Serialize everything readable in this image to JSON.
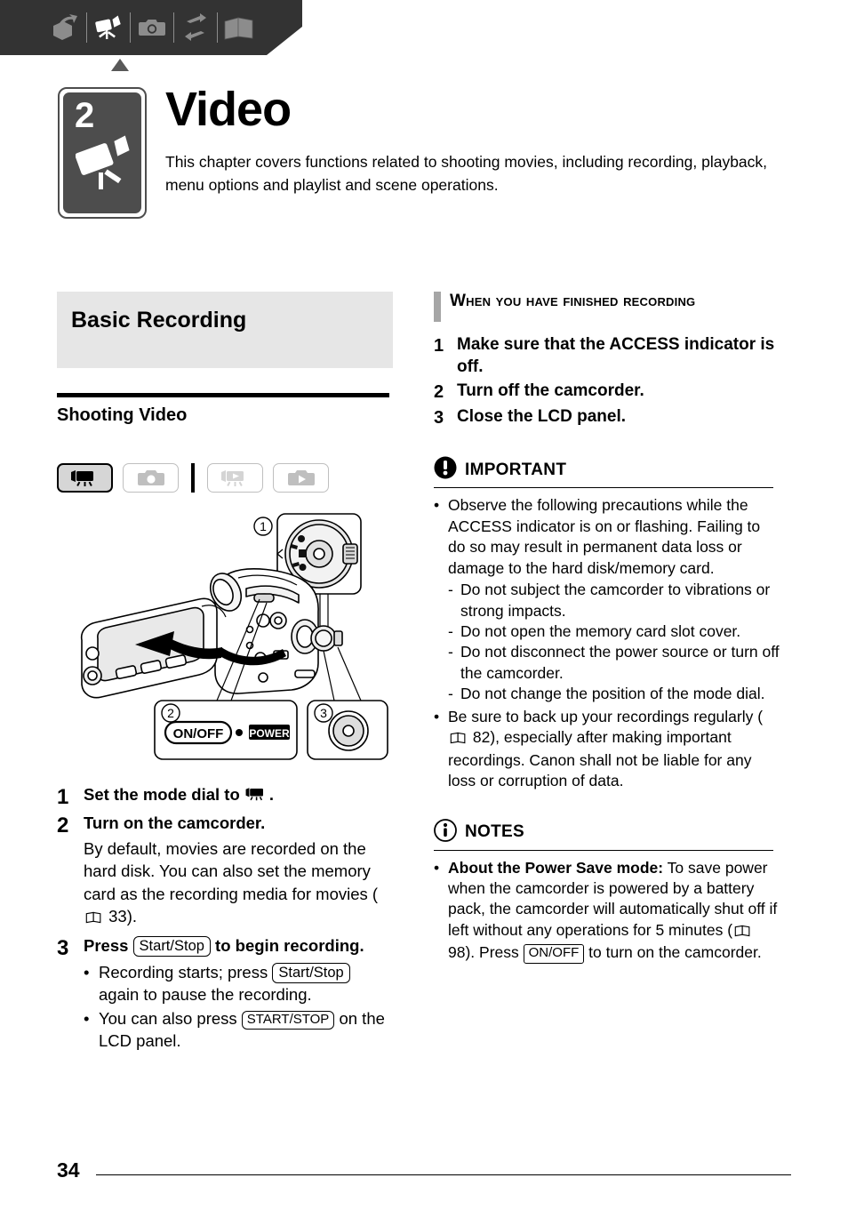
{
  "header": {
    "tabs": [
      {
        "name": "introduction-icon",
        "label": "Introduction",
        "active": false
      },
      {
        "name": "video-icon",
        "label": "Video",
        "active": true
      },
      {
        "name": "photos-icon",
        "label": "Photos",
        "active": false
      },
      {
        "name": "external-connections-icon",
        "label": "External Connections",
        "active": false
      },
      {
        "name": "additional-information-icon",
        "label": "Additional Information",
        "active": false
      }
    ]
  },
  "chapter": {
    "number": "2",
    "title": "Video",
    "description": "This chapter covers functions related to shooting movies, including recording, playback, menu options and playlist and scene operations."
  },
  "left": {
    "section_title": "Basic Recording",
    "subhead": "Shooting Video",
    "modes": [
      {
        "name": "mode-video-record",
        "label": "Video recording",
        "state": "active"
      },
      {
        "name": "mode-photo-record",
        "label": "Photo recording",
        "state": "inactive"
      },
      {
        "name": "mode-video-play",
        "label": "Video playback",
        "state": "inactive"
      },
      {
        "name": "mode-photo-play",
        "label": "Photo playback",
        "state": "inactive"
      }
    ],
    "figure": {
      "callout1": "1",
      "callout2": "2",
      "callout3": "3",
      "onoff_label": "ON/OFF",
      "power_label": "POWER"
    },
    "steps": [
      {
        "num": "1",
        "head_pre": "Set the mode dial to ",
        "head_icon": "camcorder-mode-icon",
        "head_post": ".",
        "body": "",
        "bullets": []
      },
      {
        "num": "2",
        "head_pre": "Turn on the camcorder.",
        "head_icon": "",
        "head_post": "",
        "body_pre": "By default, movies are recorded on the hard disk. You can also set the memory card as the recording media for movies (",
        "body_ref": "33",
        "body_post": ").",
        "bullets": []
      },
      {
        "num": "3",
        "head_pre": "Press ",
        "head_key": "Start/Stop",
        "head_post": " to begin recording.",
        "bullets": [
          {
            "pre": "Recording starts; press ",
            "key": "Start/Stop",
            "post": " again to pause the recording."
          },
          {
            "pre": "You can also press ",
            "key": "START/STOP",
            "post": " on the LCD panel."
          }
        ]
      }
    ]
  },
  "right": {
    "subsection_title": "When you have finished recording",
    "steps": [
      {
        "num": "1",
        "text": "Make sure that the ACCESS indicator is off."
      },
      {
        "num": "2",
        "text": "Turn off the camcorder."
      },
      {
        "num": "3",
        "text": "Close the LCD panel."
      }
    ],
    "important": {
      "label": "IMPORTANT",
      "bullets": [
        {
          "text": "Observe the following precautions while the ACCESS indicator is on or flashing. Failing to do so may result in permanent data loss or damage to the hard disk/memory card.",
          "sub": [
            "Do not subject the camcorder to vibrations or strong impacts.",
            "Do not open the memory card slot cover.",
            "Do not disconnect the power source or turn off the camcorder.",
            "Do not change the position of the mode dial."
          ]
        },
        {
          "pre": "Be sure to back up your recordings regularly (",
          "ref": "82",
          "post": "), especially after making important recordings. Canon shall not be liable for any loss or corruption of data.",
          "sub": []
        }
      ]
    },
    "notes": {
      "label": "NOTES",
      "bullets": [
        {
          "bold": "About the Power Save mode:",
          "pre": " To save power when the camcorder is powered by a battery pack, the camcorder will automatically shut off if left without any operations for 5 minutes (",
          "ref": "98",
          "mid": "). Press ",
          "key": "ON/OFF",
          "post": " to turn on the camcorder."
        }
      ]
    }
  },
  "footer": {
    "page_number": "34"
  },
  "colors": {
    "header_band": "#333333",
    "tab_icon_inactive": "#8c8c8c",
    "tab_icon_active": "#ffffff",
    "chapter_badge": "#4d4d4d",
    "section_banner": "#e6e6e6",
    "vbar": "#a6a6a6"
  }
}
